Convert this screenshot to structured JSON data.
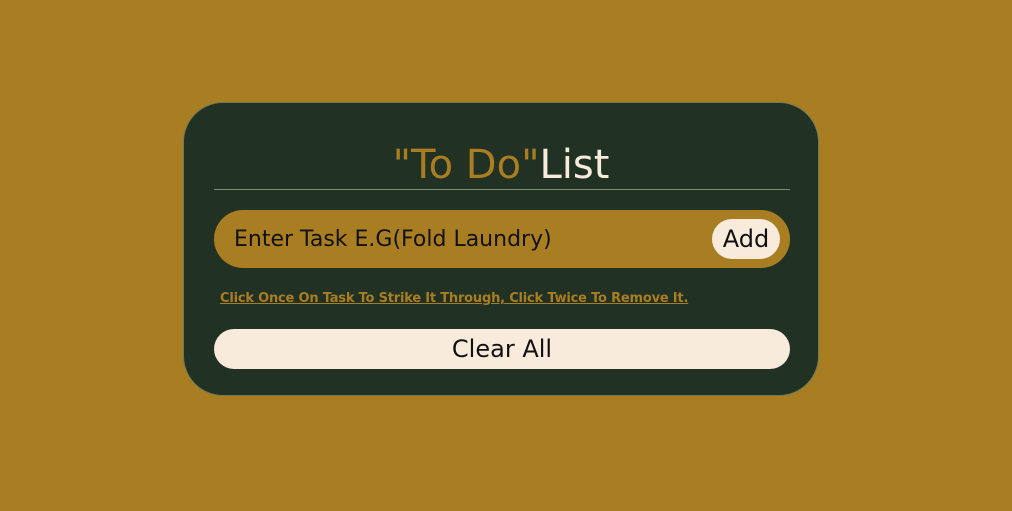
{
  "app": {
    "title_accent": "\"To Do\"",
    "title_main": "List"
  },
  "task_form": {
    "input_value": "",
    "input_placeholder": "Enter Task E.G(Fold Laundry)",
    "add_label": "Add"
  },
  "hint_text": "Click Once On Task To Strike It Through, Click Twice To Remove It.",
  "clear_label": "Clear All",
  "colors": {
    "background": "#a97e23",
    "card": "#213123",
    "accent": "#a97e23",
    "light": "#f8ebdb"
  }
}
